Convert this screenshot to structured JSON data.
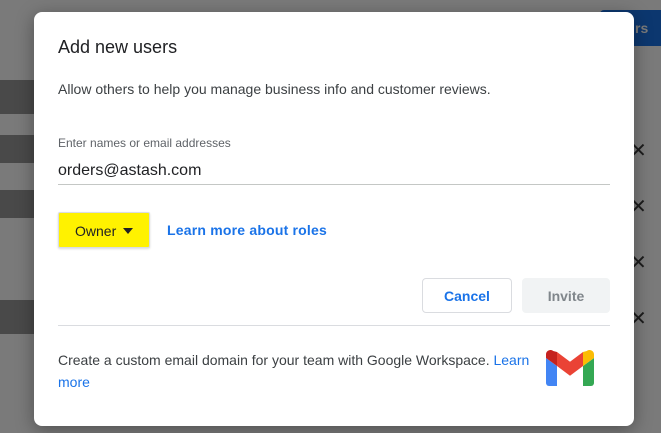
{
  "background": {
    "top_button_label": "rs",
    "close_icon_glyph": "✕"
  },
  "dialog": {
    "title": "Add new users",
    "description": "Allow others to help you manage business info and customer reviews.",
    "email_field": {
      "label": "Enter names or email addresses",
      "value": "orders@astash.com",
      "placeholder": ""
    },
    "role_dropdown": {
      "selected": "Owner",
      "highlight_color": "#fff200"
    },
    "learn_more_roles": "Learn more about roles",
    "buttons": {
      "cancel": "Cancel",
      "invite": "Invite"
    },
    "promo": {
      "text": "Create a custom email domain for your team with Google Workspace.",
      "link": "Learn more"
    },
    "logo_icon": "gmail-logo-icon"
  },
  "colors": {
    "accent": "#1a73e8",
    "highlight": "#fff200",
    "disabled_text": "#80868b"
  }
}
